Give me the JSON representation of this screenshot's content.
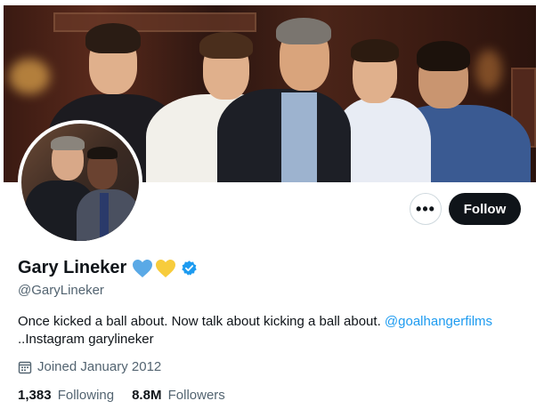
{
  "profile": {
    "display_name": "Gary Lineker",
    "handle": "@GaryLineker",
    "badges": [
      "blue-heart-icon",
      "yellow-heart-icon",
      "verified-badge-icon"
    ],
    "bio_text": "Once kicked a ball about. Now talk about kicking a ball about.",
    "bio_link": "@goalhangerfilms",
    "bio_line2": "..Instagram garylineker",
    "joined": "Joined January 2012",
    "following_count": "1,383",
    "following_label": "Following",
    "followers_count": "8.8M",
    "followers_label": "Followers"
  },
  "actions": {
    "more_label": "•••",
    "follow_label": "Follow"
  },
  "colors": {
    "accent": "#1d9bf0",
    "text_primary": "#0f1419",
    "text_secondary": "#536471",
    "follow_bg": "#0f1419"
  }
}
